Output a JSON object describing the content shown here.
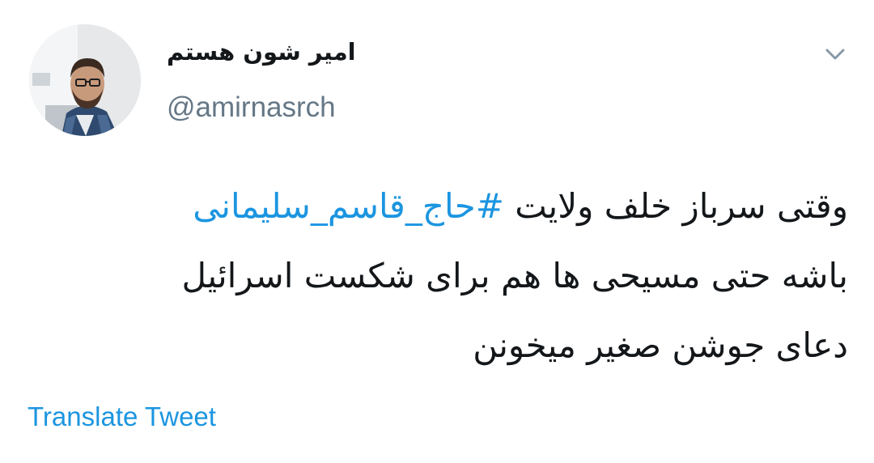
{
  "tweet": {
    "display_name": "امیر شون هستم",
    "handle": "@amirnasrch",
    "menu_icon": "chevron-down-icon",
    "avatar_icon": "profile-photo",
    "text": {
      "line1_before": "وقتی سرباز خلف ولایت ",
      "hashtag": "#حاج_قاسم_سلیمانی",
      "line2": "باشه حتی مسیحی ها هم برای شکست اسرائیل",
      "line3": "دعای جوشن صغیر میخونن"
    },
    "translate_label": "Translate Tweet"
  },
  "colors": {
    "link": "#1b95e0",
    "secondary_text": "#657786",
    "primary_text": "#14171a",
    "background": "#ffffff"
  }
}
